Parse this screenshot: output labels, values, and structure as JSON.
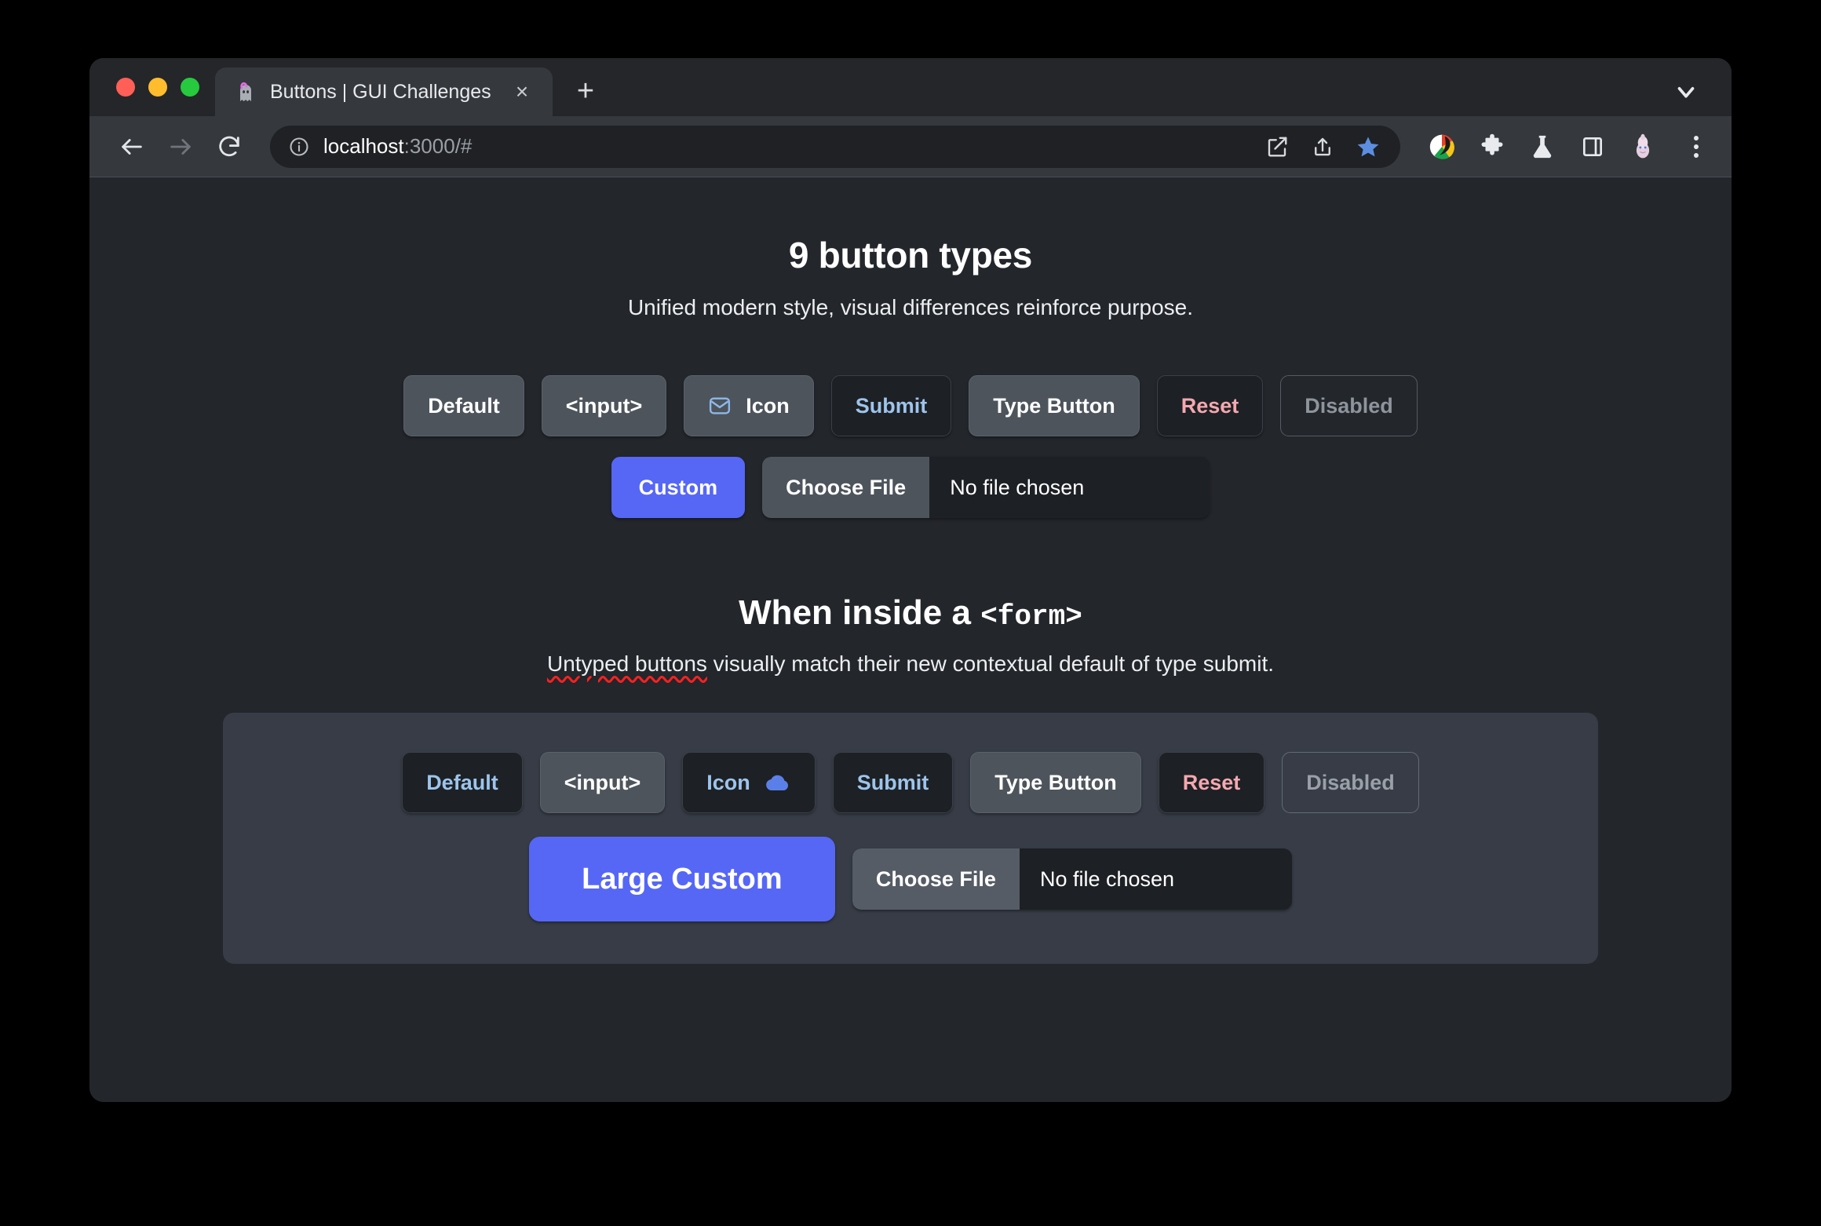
{
  "browser": {
    "tab": {
      "favicon": "ghost-icon",
      "title": "Buttons | GUI Challenges",
      "close_label": "×",
      "newtab_label": "+"
    },
    "toolbar": {
      "back": "back-arrow",
      "forward": "forward-arrow",
      "reload": "reload-icon",
      "url_main": "localhost",
      "url_dim": ":3000/#",
      "icons": [
        "open-external-icon",
        "share-icon",
        "bookmark-star-icon",
        "color-wheel-extension-icon",
        "puzzle-extension-icon",
        "flask-labs-icon",
        "side-panel-icon",
        "profile-avatar-icon",
        "kebab-menu-icon"
      ]
    }
  },
  "page": {
    "heading": "9 button types",
    "subheading": "Unified modern style, visual differences reinforce purpose.",
    "heading2_prefix": "When inside a ",
    "heading2_code": "<form>",
    "subheading2_a": "Untyped buttons",
    "subheading2_b": " visually match their new contextual default of type submit.",
    "buttons_row1": [
      {
        "label": "Default",
        "style": "neutral",
        "icon": ""
      },
      {
        "label": "<input>",
        "style": "neutral",
        "icon": ""
      },
      {
        "label": "Icon",
        "style": "neutral",
        "icon": "✉️",
        "icon_side": "left",
        "icon_name": "envelope-icon"
      },
      {
        "label": "Submit",
        "style": "submit",
        "icon": ""
      },
      {
        "label": "Type Button",
        "style": "neutral",
        "icon": ""
      },
      {
        "label": "Reset",
        "style": "reset",
        "icon": ""
      },
      {
        "label": "Disabled",
        "style": "disabled",
        "icon": ""
      }
    ],
    "custom_button": "Custom",
    "file_input": {
      "button": "Choose File",
      "status": "No file chosen"
    },
    "form_buttons": [
      {
        "label": "Default",
        "style": "submit",
        "icon": ""
      },
      {
        "label": "<input>",
        "style": "neutral",
        "icon": ""
      },
      {
        "label": "Icon",
        "style": "submit",
        "icon": "☁️",
        "icon_side": "right",
        "icon_name": "cloud-icon"
      },
      {
        "label": "Submit",
        "style": "submit",
        "icon": ""
      },
      {
        "label": "Type Button",
        "style": "neutral",
        "icon": ""
      },
      {
        "label": "Reset",
        "style": "reset",
        "icon": ""
      },
      {
        "label": "Disabled",
        "style": "disabled",
        "icon": ""
      }
    ],
    "form_custom_button": "Large Custom",
    "form_file_input": {
      "button": "Choose File",
      "status": "No file chosen"
    }
  },
  "colors": {
    "accent_blue": "#5667f6",
    "submit_text": "#9dc4ec",
    "reset_text": "#f4a8b0",
    "neutral_bg": "#4d545c",
    "page_bg": "#23262b",
    "form_bg": "#373c46"
  }
}
